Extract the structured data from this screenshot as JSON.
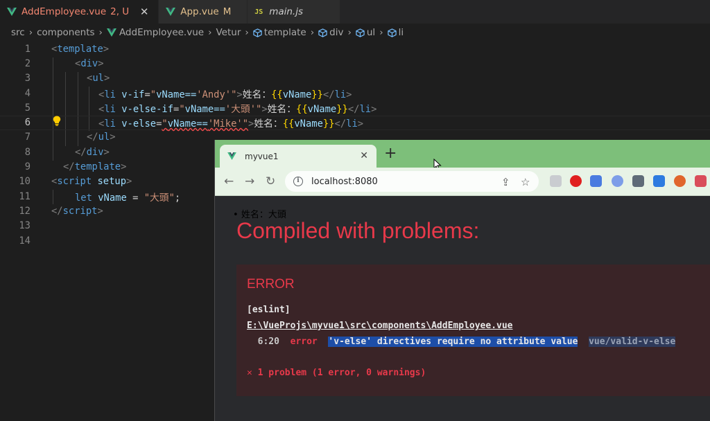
{
  "editor": {
    "tabs": [
      {
        "label": "AddEmployee.vue",
        "badge": "2, U",
        "close": "✕"
      },
      {
        "label": "App.vue",
        "badge": "M"
      },
      {
        "label": "main.js",
        "icon_text": "JS"
      }
    ],
    "breadcrumb": [
      "src",
      "components",
      "AddEmployee.vue",
      "Vetur",
      "template",
      "div",
      "ul",
      "li"
    ],
    "line_numbers": [
      "1",
      "2",
      "3",
      "4",
      "5",
      "6",
      "7",
      "8",
      "9",
      "10",
      "11",
      "12",
      "13",
      "14"
    ],
    "code": {
      "l1_tag": "template",
      "l2_tag": "div",
      "l3_tag": "ul",
      "li_tag": "li",
      "l4_dir": "v-if",
      "l4_val_a": "vName==",
      "l4_val_b": "'Andy'",
      "l5_dir": "v-else-if",
      "l5_val_a": "vName==",
      "l5_val_b": "'大頭'",
      "l6_dir": "v-else",
      "l6_val_a": "vName==",
      "l6_val_b": "'Mike'",
      "text": "姓名：",
      "mus_open": "{{",
      "mus_var": "vName",
      "mus_close": "}}",
      "l10_tag": "script",
      "l10_attr": "setup",
      "l11_kw": "let",
      "l11_var": "vName",
      "l11_str": "\"大頭\"",
      "l12_tag": "script"
    }
  },
  "browser": {
    "tab_title": "myvue1",
    "tab_close": "✕",
    "new_tab": "+",
    "url": "localhost:8080",
    "page": {
      "bullet_text": "姓名：大頭",
      "heading": "Compiled with problems:",
      "error_title": "ERROR",
      "source": "[eslint]",
      "path": "E:\\VueProjs\\myvue1\\src\\components\\AddEmployee.vue",
      "location": "6:20",
      "level": "error",
      "message": "'v-else' directives require no attribute value",
      "rule": "vue/valid-v-else",
      "summary": "✕ 1 problem (1 error, 0 warnings)"
    }
  },
  "colors": {
    "vue_green": "#41b883",
    "vue_dark": "#35495e",
    "error_red": "#e8394a",
    "browser_frame_green": "#7dbf7a"
  }
}
